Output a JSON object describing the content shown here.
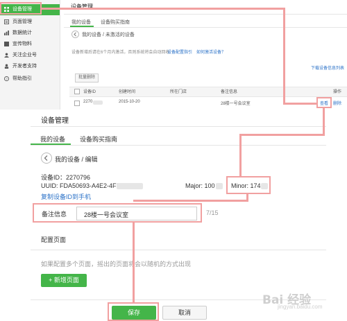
{
  "top": {
    "sidebar": {
      "items": [
        {
          "icon": "grid-icon",
          "label": "设备管理",
          "active": true
        },
        {
          "icon": "page-icon",
          "label": "页面管理"
        },
        {
          "icon": "stats-icon",
          "label": "数据统计"
        },
        {
          "icon": "material-icon",
          "label": "宣传物料"
        },
        {
          "icon": "account-icon",
          "label": "关注企业号"
        },
        {
          "icon": "dev-icon",
          "label": "开发者支持"
        },
        {
          "icon": "help-icon",
          "label": "帮助指引"
        }
      ]
    },
    "page_title": "设备管理",
    "tabs": [
      "我的设备",
      "设备购买指南"
    ],
    "breadcrumb": "我的设备 / 未激活的设备",
    "notice": "设备新增后请在6个月内激活，否则系统将会自动回收",
    "notice_link1": "设备配置指引",
    "notice_link2": "如何激活设备？",
    "download_link": "下载设备信息列表",
    "batch_delete": "批量删除",
    "table": {
      "headers": [
        "设备ID",
        "创建时间",
        "所在门店",
        "备注信息",
        "操作"
      ],
      "row": {
        "id": "2270",
        "created": "2015-10-20",
        "store": "",
        "note": "28楼一号会议室",
        "view": "查看",
        "delete": "删除"
      }
    }
  },
  "bottom": {
    "page_title": "设备管理",
    "tabs": [
      "我的设备",
      "设备购买指南"
    ],
    "breadcrumb": "我的设备 / 编辑",
    "device_id": "设备ID：2270796",
    "uuid": "UUID: FDA50693-A4E2-4FB1",
    "major": "Major: 100",
    "minor": "Minor: 174",
    "copy_link": "复制设备ID到手机",
    "note_label": "备注信息",
    "note_value": "28楼一号会议室",
    "note_count": "7/15",
    "config_title": "配置页面",
    "config_hint": "如果配置多个页面，摇出的页面将会以随机的方式出现",
    "add_page": "+ 新增页面",
    "save": "保存",
    "cancel": "取消",
    "watermark": "Bai 经验",
    "watermark_url": "jingyan.baidu.com"
  },
  "colors": {
    "green": "#44b549",
    "highlight": "#f1a0a0",
    "link": "#2d73c8"
  }
}
